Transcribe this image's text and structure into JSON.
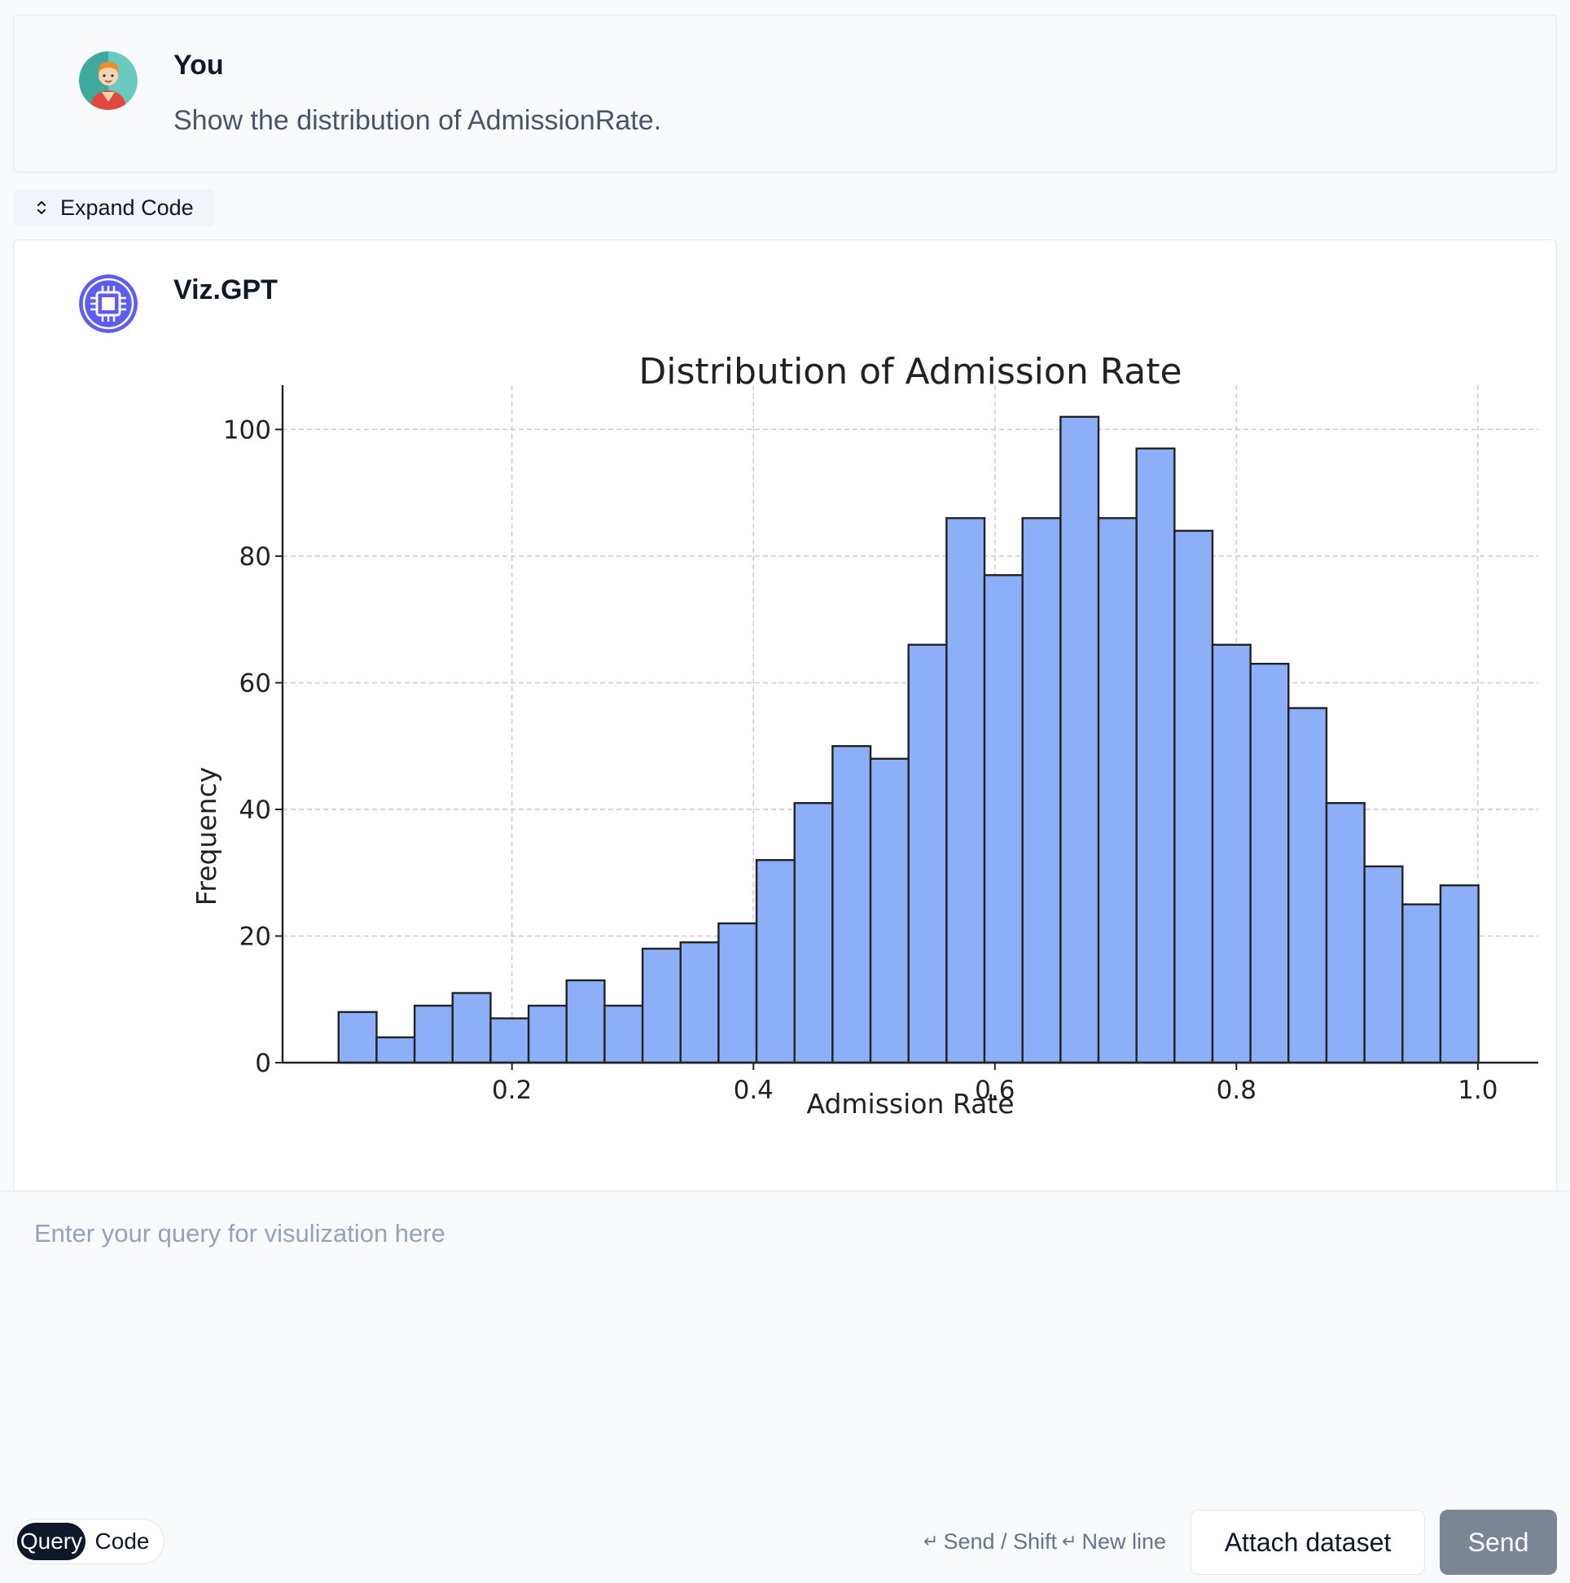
{
  "user_message": {
    "author": "You",
    "text": "Show the distribution of AdmissionRate."
  },
  "toolbar": {
    "expand_code_label": "Expand Code"
  },
  "bot_message": {
    "author": "Viz.GPT"
  },
  "chart_data": {
    "type": "bar",
    "title": "Distribution of Admission Rate",
    "xlabel": "Admission Rate",
    "ylabel": "Frequency",
    "xlim": [
      0.01,
      1.05
    ],
    "ylim": [
      0,
      107
    ],
    "x_ticks": [
      "0.2",
      "0.4",
      "0.6",
      "0.8",
      "1.0"
    ],
    "y_ticks": [
      "0",
      "20",
      "40",
      "60",
      "80",
      "100"
    ],
    "grid": true,
    "bar_color": "#8caff8",
    "bin_start": 0.0564,
    "bin_width": 0.03147,
    "values": [
      8,
      4,
      9,
      11,
      7,
      9,
      13,
      9,
      18,
      19,
      22,
      32,
      41,
      50,
      48,
      66,
      86,
      77,
      86,
      102,
      86,
      97,
      84,
      66,
      63,
      56,
      41,
      31,
      25,
      28
    ]
  },
  "input": {
    "placeholder": "Enter your query for visulization here",
    "value": ""
  },
  "mode_toggle": {
    "query_label": "Query",
    "code_label": "Code",
    "active": "Query"
  },
  "hint": {
    "enter_symbol": "↵",
    "send_text": "Send / Shift",
    "newline_text": "New line"
  },
  "buttons": {
    "attach_label": "Attach dataset",
    "send_label": "Send"
  },
  "colors": {
    "send_button": "#7c8594",
    "bot_avatar": "#5b5ef0",
    "user_avatar_bg": "#6cc9c0"
  }
}
